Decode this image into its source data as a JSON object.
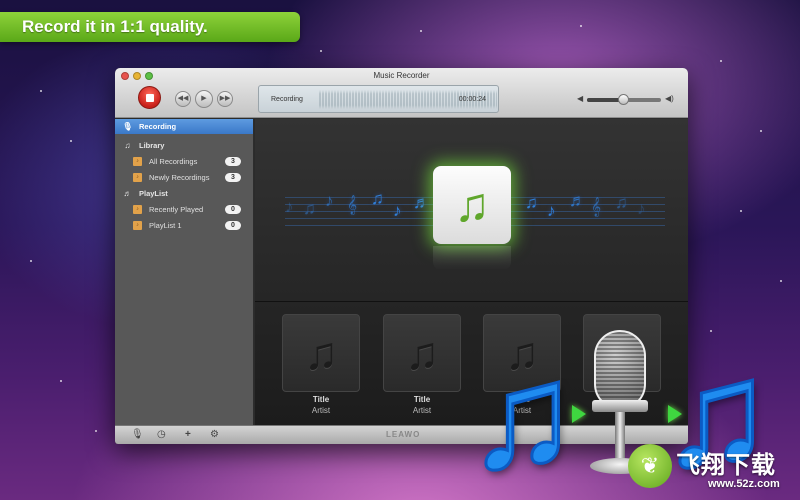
{
  "banner": {
    "text": "Record it in 1:1 quality."
  },
  "window": {
    "title": "Music Recorder",
    "lcd": {
      "label": "Recording",
      "time": "00:00:24"
    },
    "volume": {
      "level": 0.5
    }
  },
  "sidebar": {
    "recording": {
      "label": "Recording"
    },
    "library": {
      "label": "Library"
    },
    "all_recordings": {
      "label": "All Recordings",
      "count": "3"
    },
    "newly_recordings": {
      "label": "Newly Recordings",
      "count": "3"
    },
    "playlist": {
      "label": "PlayList"
    },
    "recently_played": {
      "label": "Recently Played",
      "count": "0"
    },
    "playlist_1": {
      "label": "PlayList 1",
      "count": "0"
    }
  },
  "shelf": {
    "cards": [
      {
        "title": "Title",
        "artist": "Artist"
      },
      {
        "title": "Title",
        "artist": "Artist"
      },
      {
        "title": "Title",
        "artist": "Artist"
      },
      {
        "title": "",
        "artist": ""
      }
    ]
  },
  "bottombar": {
    "brand": "LEAWO"
  },
  "watermark": {
    "text": "飞翔下载",
    "sub": "www.52z.com"
  },
  "icons": {
    "note": "♫",
    "mic": "🎙"
  }
}
